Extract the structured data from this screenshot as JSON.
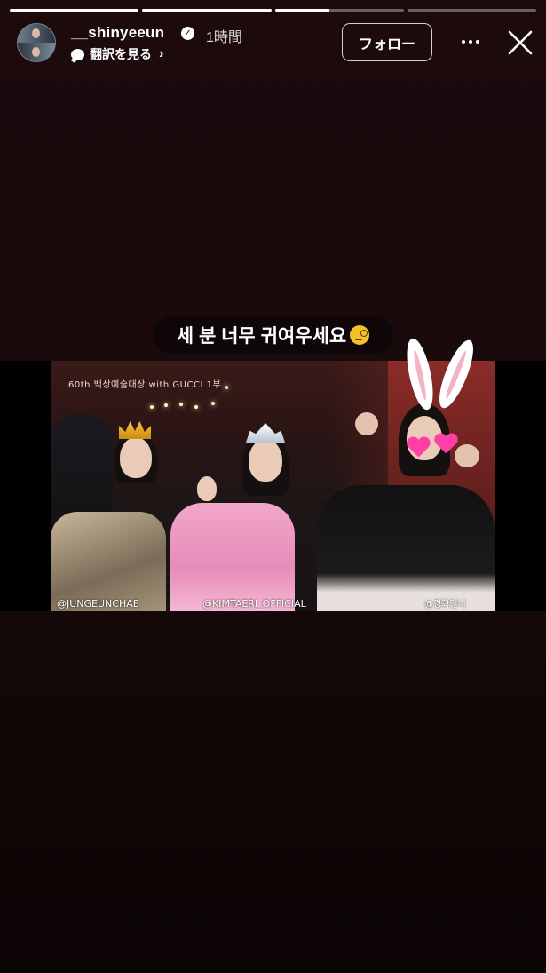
{
  "progress": [
    {
      "state": "viewed",
      "fill": 1.0
    },
    {
      "state": "viewed",
      "fill": 1.0
    },
    {
      "state": "current",
      "fill": 0.42
    },
    {
      "state": "unviewed",
      "fill": 0.0
    }
  ],
  "header": {
    "username": "__shinyeeun",
    "verified": true,
    "time": "1時間",
    "translate_label": "翻訳を見る",
    "follow_label": "フォロー"
  },
  "story": {
    "caption": "세 분 너무 귀여우세요",
    "caption_emoji": "monocle-face-emoji",
    "media": {
      "broadcast_logo": "60th 백상예술대상 with GUCCI 1부",
      "tags": [
        "@JUNGEUNCHAE",
        "@KIMTAERI_OFFICIAL",
        "@경화언니"
      ],
      "stickers": [
        "crown-sticker",
        "tiara-sticker",
        "bunny-ears-sticker",
        "heart-sticker"
      ]
    }
  },
  "colors": {
    "background_top": "#1c0a0d",
    "background_bottom": "#0b0404",
    "accent_pink": "#ff3fa6"
  }
}
